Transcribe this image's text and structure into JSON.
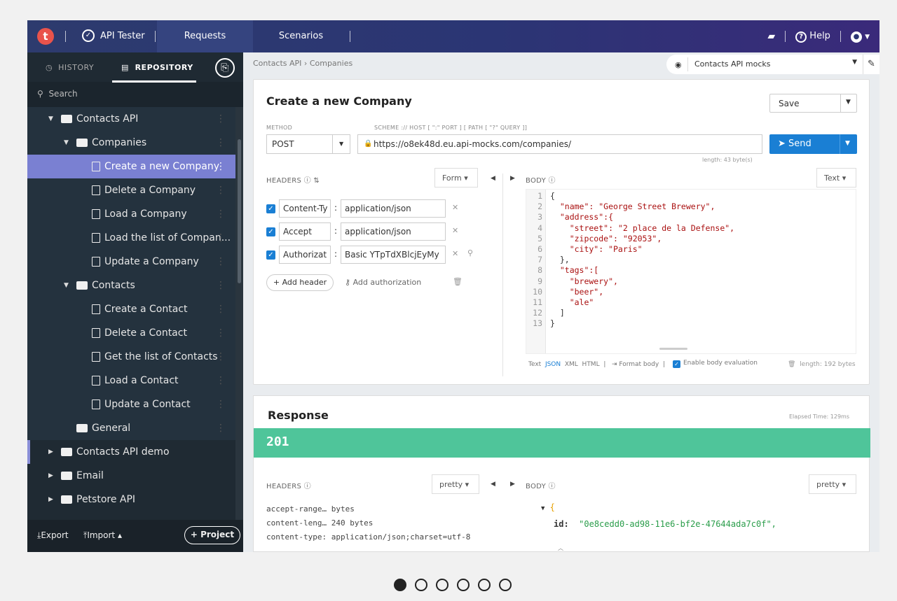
{
  "topbar": {
    "logo": "t",
    "app_name": "API Tester",
    "tabs": [
      "Requests",
      "Scenarios"
    ],
    "help": "Help",
    "icons": [
      "chat-icon",
      "help-icon",
      "user-icon"
    ]
  },
  "sidebar": {
    "tab_history": "HISTORY",
    "tab_repository": "REPOSITORY",
    "search_placeholder": "Search",
    "tree": [
      {
        "label": "Contacts API",
        "type": "project",
        "expanded": true
      },
      {
        "label": "Companies",
        "type": "folder",
        "expanded": true
      },
      {
        "label": "Create a new Company",
        "type": "request",
        "selected": true
      },
      {
        "label": "Delete a Company",
        "type": "request"
      },
      {
        "label": "Load a Company",
        "type": "request"
      },
      {
        "label": "Load the list of Compan...",
        "type": "request"
      },
      {
        "label": "Update a Company",
        "type": "request"
      },
      {
        "label": "Contacts",
        "type": "folder",
        "expanded": true
      },
      {
        "label": "Create a Contact",
        "type": "request"
      },
      {
        "label": "Delete a Contact",
        "type": "request"
      },
      {
        "label": "Get the list of Contacts",
        "type": "request"
      },
      {
        "label": "Load a Contact",
        "type": "request"
      },
      {
        "label": "Update a Contact",
        "type": "request"
      },
      {
        "label": "General",
        "type": "folder"
      },
      {
        "label": "Contacts API demo",
        "type": "project"
      },
      {
        "label": "Email",
        "type": "project"
      },
      {
        "label": "Petstore API",
        "type": "project"
      }
    ],
    "footer": {
      "export": "Export",
      "import": "Import",
      "project": "+ Project"
    }
  },
  "main": {
    "breadcrumb": "Contacts API  ›  Companies",
    "env": "Contacts API mocks",
    "request": {
      "title": "Create a new Company",
      "save": "Save",
      "method_label": "METHOD",
      "url_label": "SCHEME :// HOST [ \":\" PORT ] [ PATH [ \"?\" QUERY ]]",
      "method": "POST",
      "url": "https://o8ek48d.eu.api-mocks.com/companies/",
      "send": "Send",
      "length": "length: 43 byte(s)",
      "headers_label": "HEADERS",
      "form_btn": "Form",
      "body_label": "BODY",
      "text_btn": "Text",
      "headers": [
        {
          "key": "Content-Ty",
          "value": "application/json"
        },
        {
          "key": "Accept",
          "value": "application/json"
        },
        {
          "key": "Authorizat",
          "value": "Basic YTpTdXBlcjEyMy"
        }
      ],
      "add_header": "+ Add header",
      "add_authorization": "Add authorization",
      "body_lines": [
        "{",
        "  \"name\": \"George Street Brewery\",",
        "  \"address\":{",
        "    \"street\": \"2 place de la Defense\",",
        "    \"zipcode\": \"92053\",",
        "    \"city\": \"Paris\"",
        "  },",
        "  \"tags\":[",
        "    \"brewery\",",
        "    \"beer\",",
        "    \"ale\"",
        "  ]",
        "}"
      ],
      "body_formats": [
        "Text",
        "JSON",
        "XML",
        "HTML"
      ],
      "format_body": "Format body",
      "enable_eval": "Enable body evaluation",
      "body_length": "length: 192 bytes"
    },
    "response": {
      "title": "Response",
      "elapsed": "Elapsed Time: 129ms",
      "status": "201",
      "headers_label": "HEADERS",
      "pretty": "pretty",
      "body_label": "BODY",
      "headers": [
        "accept-range…  bytes",
        "content-leng…  240 bytes",
        "content-type:  application/json;charset=utf-8"
      ],
      "body_id_key": "id:",
      "body_id_val": "\"0e8cedd0-ad98-11e6-bf2e-47644ada7c0f\","
    }
  },
  "carousel": {
    "count": 6,
    "active": 0
  }
}
